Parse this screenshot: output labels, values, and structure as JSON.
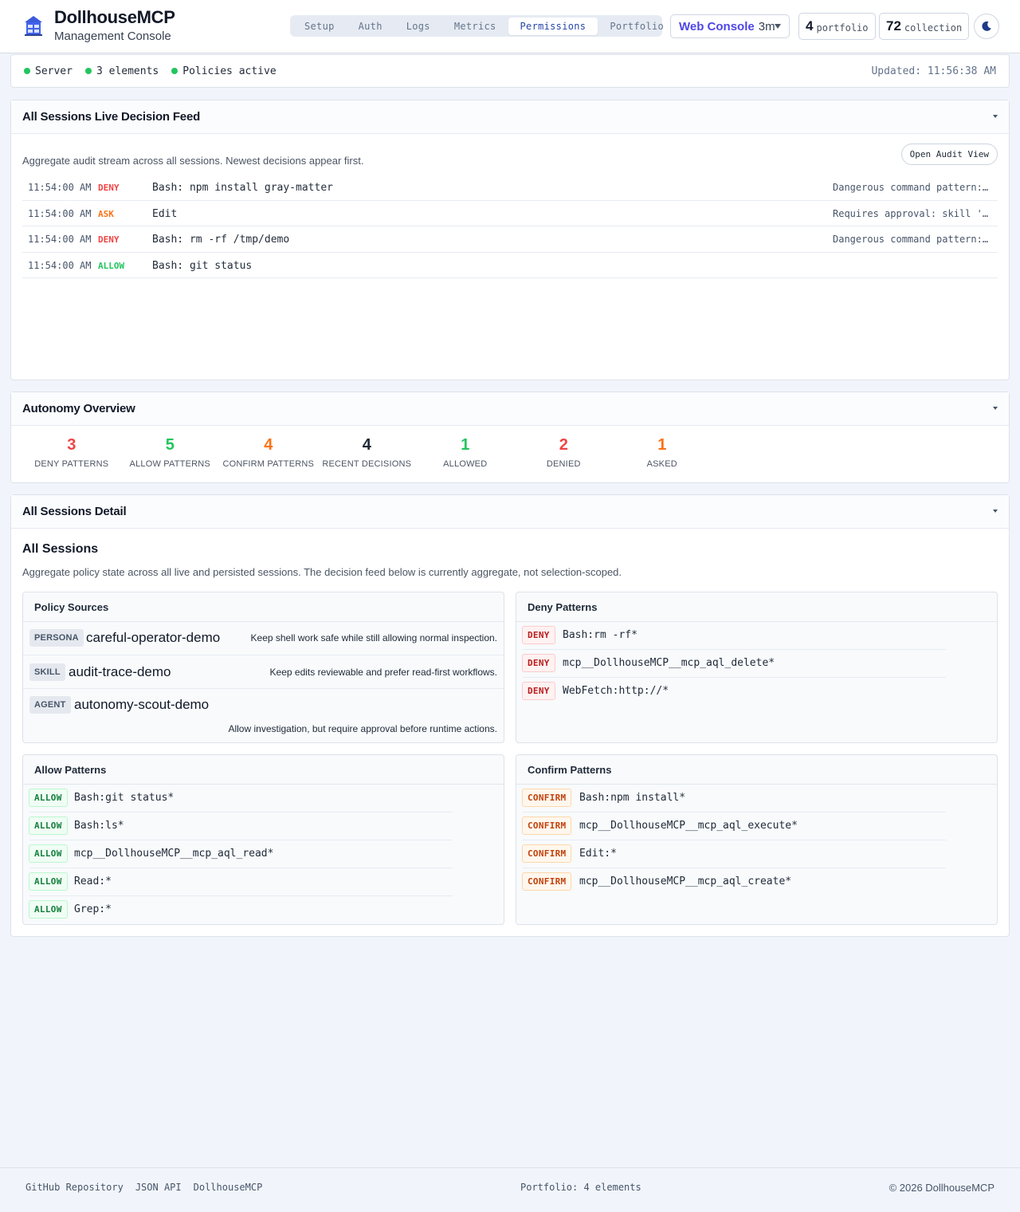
{
  "header": {
    "title": "DollhouseMCP",
    "subtitle": "Management Console",
    "tabs": [
      {
        "label": "Setup"
      },
      {
        "label": "Auth"
      },
      {
        "label": "Logs"
      },
      {
        "label": "Metrics"
      },
      {
        "label": "Permissions",
        "active": true
      },
      {
        "label": "Portfolio"
      }
    ],
    "console_name": "Web Console",
    "console_age": "3m",
    "portfolio_count": "4",
    "portfolio_label": "portfolio",
    "collection_count": "72",
    "collection_label": "collection",
    "theme_icon": "moon-icon"
  },
  "status": {
    "server": "Server",
    "elements": "3 elements",
    "policies": "Policies active",
    "updated": "Updated: 11:56:38 AM"
  },
  "feed": {
    "title": "All Sessions Live Decision Feed",
    "description": "Aggregate audit stream across all sessions. Newest decisions appear first.",
    "audit_button": "Open Audit View",
    "rows": [
      {
        "time": "11:54:00 AM",
        "decision": "DENY",
        "tool": "Bash: npm install gray-matter",
        "reason": "Dangerous command pattern:…"
      },
      {
        "time": "11:54:00 AM",
        "decision": "ASK",
        "tool": "Edit",
        "reason": "Requires approval: skill '…"
      },
      {
        "time": "11:54:00 AM",
        "decision": "DENY",
        "tool": "Bash: rm -rf /tmp/demo",
        "reason": "Dangerous command pattern:…"
      },
      {
        "time": "11:54:00 AM",
        "decision": "ALLOW",
        "tool": "Bash: git status",
        "reason": ""
      }
    ]
  },
  "autonomy": {
    "title": "Autonomy Overview",
    "stats": [
      {
        "value": "3",
        "label": "DENY PATTERNS",
        "color": "#ef4444"
      },
      {
        "value": "5",
        "label": "ALLOW PATTERNS",
        "color": "#22c55e"
      },
      {
        "value": "4",
        "label": "CONFIRM PATTERNS",
        "color": "#f97316"
      },
      {
        "value": "4",
        "label": "RECENT DECISIONS",
        "color": "#1f2937"
      },
      {
        "value": "1",
        "label": "ALLOWED",
        "color": "#22c55e"
      },
      {
        "value": "2",
        "label": "DENIED",
        "color": "#ef4444"
      },
      {
        "value": "1",
        "label": "ASKED",
        "color": "#f97316"
      }
    ]
  },
  "detail": {
    "panel_title": "All Sessions Detail",
    "title": "All Sessions",
    "description": "Aggregate policy state across all live and persisted sessions. The decision feed below is currently aggregate, not selection-scoped.",
    "policy_sources": {
      "title": "Policy Sources",
      "items": [
        {
          "type": "PERSONA",
          "name": "careful-operator-demo",
          "desc": "Keep shell work safe while still allowing normal inspection."
        },
        {
          "type": "SKILL",
          "name": "audit-trace-demo",
          "desc": "Keep edits reviewable and prefer read-first workflows."
        },
        {
          "type": "AGENT",
          "name": "autonomy-scout-demo",
          "desc": "Allow investigation, but require approval before runtime actions."
        }
      ]
    },
    "deny_patterns": {
      "title": "Deny Patterns",
      "badge": "DENY",
      "items": [
        "Bash:rm -rf*",
        "mcp__DollhouseMCP__mcp_aql_delete*",
        "WebFetch:http://*"
      ]
    },
    "allow_patterns": {
      "title": "Allow Patterns",
      "badge": "ALLOW",
      "items": [
        "Bash:git status*",
        "Bash:ls*",
        "mcp__DollhouseMCP__mcp_aql_read*",
        "Read:*",
        "Grep:*"
      ]
    },
    "confirm_patterns": {
      "title": "Confirm Patterns",
      "badge": "CONFIRM",
      "items": [
        "Bash:npm install*",
        "mcp__DollhouseMCP__mcp_aql_execute*",
        "Edit:*",
        "mcp__DollhouseMCP__mcp_aql_create*"
      ]
    }
  },
  "footer": {
    "links": [
      "GitHub Repository",
      "JSON API",
      "DollhouseMCP"
    ],
    "portfolio": "Portfolio: 4 elements",
    "copyright": "© 2026 DollhouseMCP"
  }
}
